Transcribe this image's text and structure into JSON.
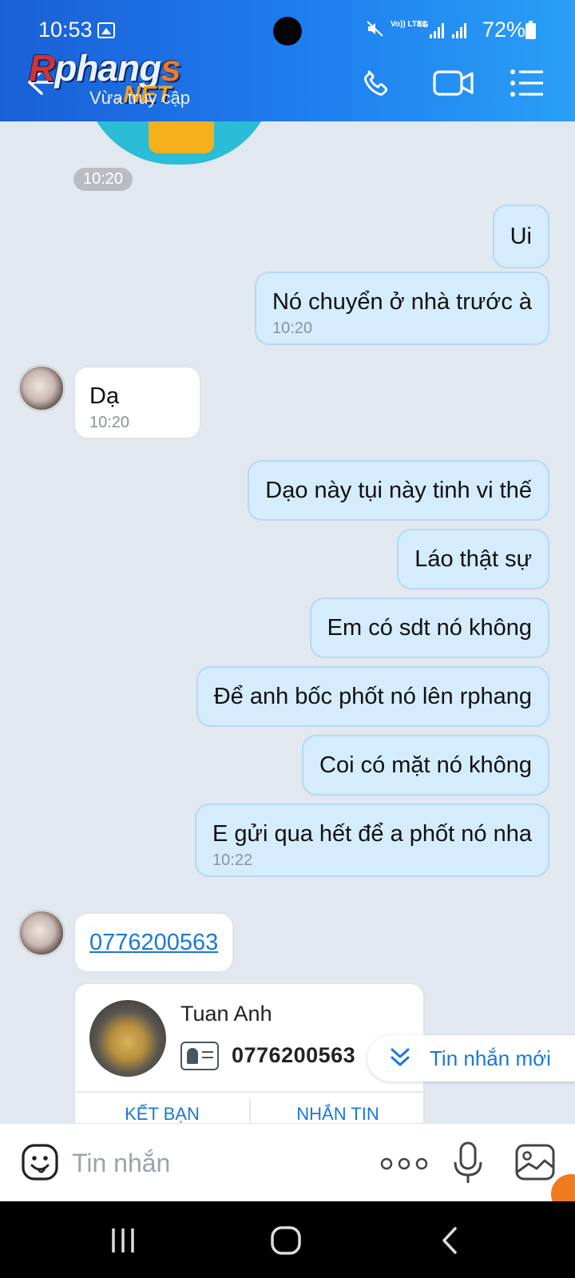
{
  "status_bar": {
    "time": "10:53",
    "volte": "Vo)) LTE1",
    "network": "4G",
    "battery": "72%"
  },
  "header": {
    "back_icon": "arrow-left-icon",
    "logo_text": "Rphangs",
    "logo_net": ".NET",
    "subtitle": "Vừa truy cập",
    "call_icon": "phone-icon",
    "video_icon": "video-camera-icon",
    "menu_icon": "list-menu-icon",
    "colors": {
      "gradient_start": "#1a5fd6",
      "gradient_end": "#2a9ff5"
    }
  },
  "chat": {
    "time_separator": "10:20",
    "messages": [
      {
        "from": "me",
        "text": "Ui",
        "time": ""
      },
      {
        "from": "me",
        "text": "Nó chuyển ở nhà trước à",
        "time": "10:20"
      },
      {
        "from": "them",
        "text": "Dạ",
        "time": "10:20"
      },
      {
        "from": "me",
        "text": "Dạo này tụi này tinh vi thế",
        "time": ""
      },
      {
        "from": "me",
        "text": "Láo thật sự",
        "time": ""
      },
      {
        "from": "me",
        "text": "Em có sdt nó không",
        "time": ""
      },
      {
        "from": "me",
        "text": "Để anh bốc phốt nó lên rphang",
        "time": ""
      },
      {
        "from": "me",
        "text": "Coi có mặt nó không",
        "time": ""
      },
      {
        "from": "me",
        "text": "E gửi qua hết để a phốt nó nha",
        "time": "10:22"
      },
      {
        "from": "them",
        "text": "0776200563",
        "time": ""
      }
    ],
    "contact_card": {
      "name": "Tuan Anh",
      "phone": "0776200563",
      "add_friend_label": "KẾT BẠN",
      "message_label": "NHẮN TIN"
    },
    "new_messages_label": "Tin nhắn mới",
    "colors": {
      "outgoing_bubble": "#d4ecfc",
      "incoming_bubble": "#ffffff",
      "link": "#1a78d6"
    }
  },
  "input_bar": {
    "placeholder": "Tin nhắn",
    "emoji_icon": "emoji-smile-icon",
    "more_icon": "more-dots-icon",
    "mic_icon": "microphone-icon",
    "image_icon": "image-icon"
  },
  "nav_bar": {
    "recents_icon": "recents-icon",
    "home_icon": "home-icon",
    "back_icon": "back-chevron-icon"
  }
}
